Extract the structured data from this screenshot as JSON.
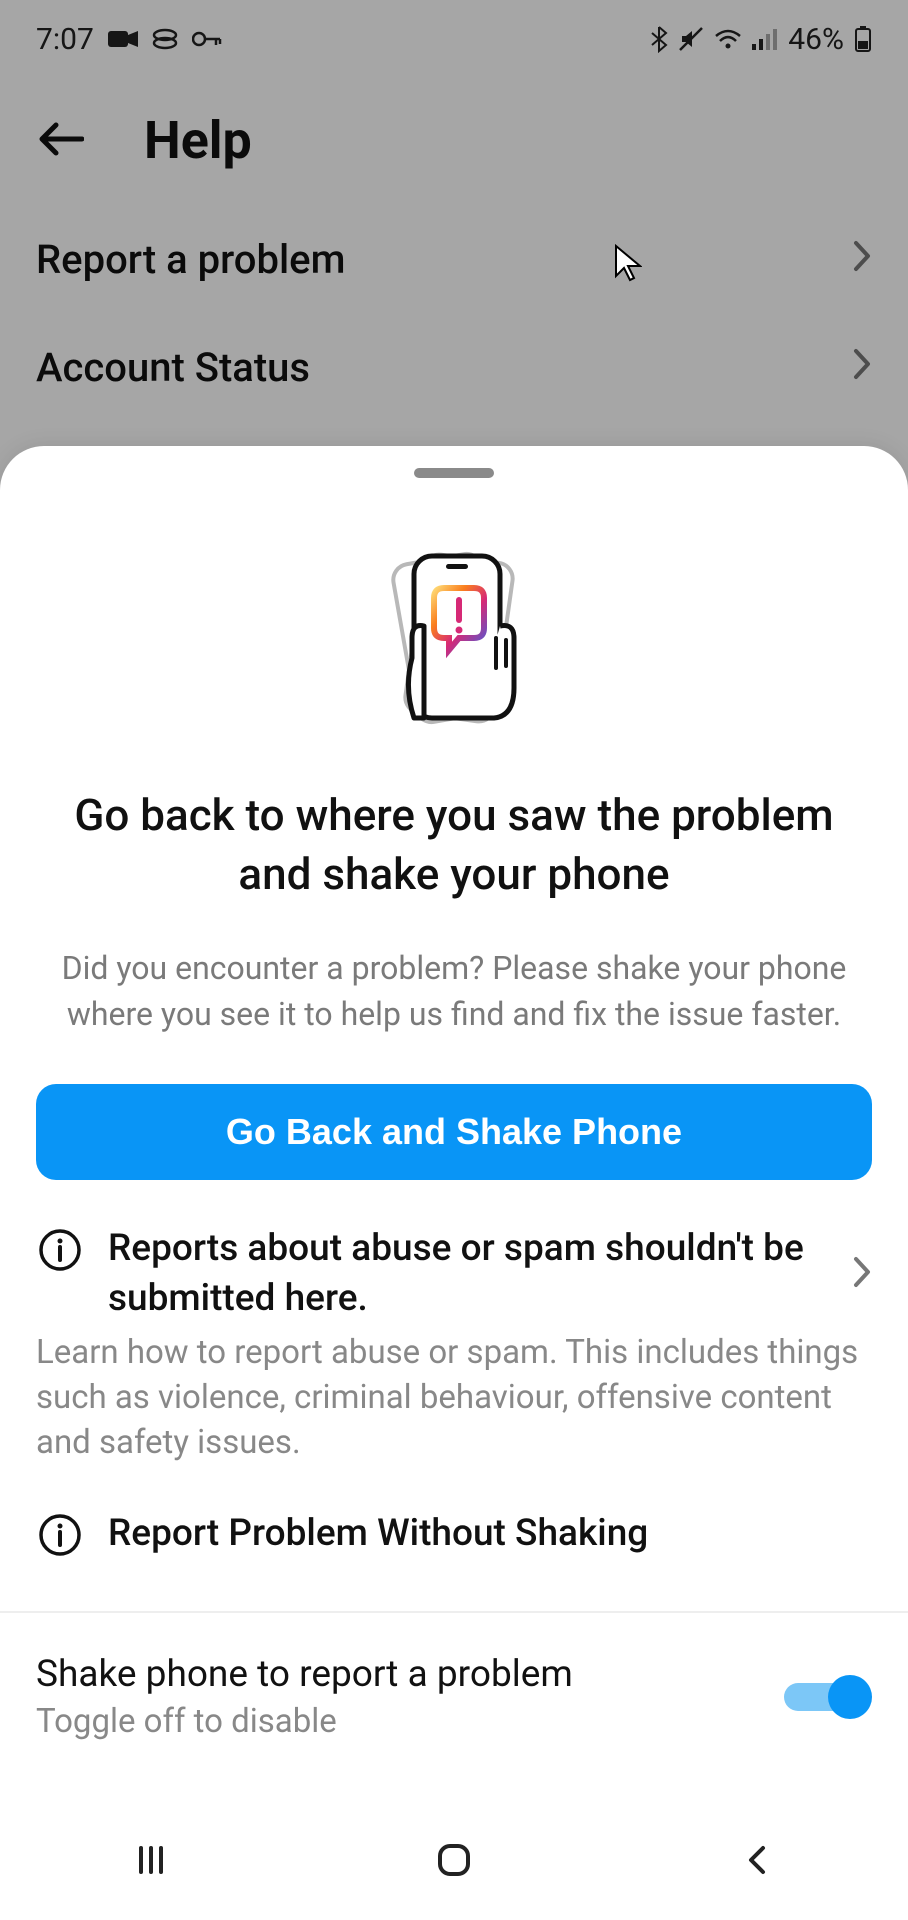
{
  "status": {
    "time": "7:07",
    "battery_text": "46%"
  },
  "help": {
    "title": "Help",
    "rows": [
      {
        "label": "Report a problem"
      },
      {
        "label": "Account Status"
      }
    ]
  },
  "sheet": {
    "title": "Go back to where you saw the problem and shake your phone",
    "subtitle": "Did you encounter a problem? Please shake your phone where you see it to help us find and fix the issue faster.",
    "primary_button": "Go Back and Shake Phone",
    "abuse": {
      "title": "Reports about abuse or spam shouldn't be submitted here.",
      "desc": "Learn how to report abuse or spam. This includes things such as violence, criminal behaviour, offensive content and safety issues."
    },
    "report_without_shaking": "Report Problem Without Shaking",
    "toggle": {
      "title": "Shake phone to report a problem",
      "subtitle": "Toggle off to disable",
      "on": true
    }
  },
  "colors": {
    "primary": "#0995f6"
  }
}
